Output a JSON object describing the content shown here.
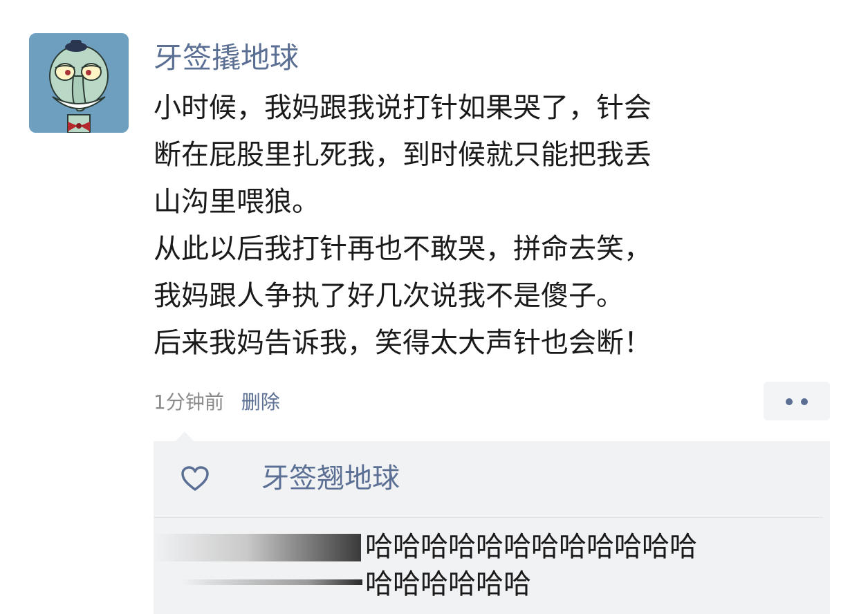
{
  "post": {
    "avatar_icon": "squidward-avatar-icon",
    "username": "牙签撬地球",
    "text_lines": [
      "小时候，我妈跟我说打针如果哭了，针会",
      "断在屁股里扎死我，到时候就只能把我丢",
      "山沟里喂狼。",
      "从此以后我打针再也不敢哭，拼命去笑，",
      "我妈跟人争执了好几次说我不是傻子。",
      "后来我妈告诉我，笑得太大声针也会断！"
    ],
    "time": "1分钟前",
    "delete_label": "删除",
    "more_icon": "more-dots-icon"
  },
  "likes": {
    "icon": "heart-outline-icon",
    "liker": "牙签翘地球"
  },
  "comment": {
    "text_lines": [
      "哈哈哈哈哈哈哈哈哈哈哈哈",
      "哈哈哈哈哈哈"
    ]
  },
  "colors": {
    "link": "#5a6f93",
    "text": "#1a1a1a",
    "meta": "#8a8a8a",
    "panel": "#f1f2f4",
    "avatar_bg": "#6f9fbf"
  }
}
